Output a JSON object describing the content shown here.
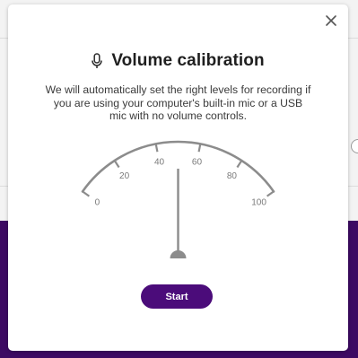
{
  "dialog": {
    "title": "Volume calibration",
    "description": "We will automatically set the right levels for recording if you are using your computer's built-in mic or a USB mic with no volume controls.",
    "close_icon": "close-icon",
    "title_icon": "microphone-icon",
    "start_label": "Start",
    "accent_color": "#4b0c7a"
  },
  "gauge": {
    "min": 0,
    "max": 100,
    "tick_labels": [
      "0",
      "20",
      "40",
      "60",
      "80",
      "100"
    ],
    "needle_value": 50,
    "color": "#8c8c8c"
  },
  "background": {
    "bottom_color": "#3d0a63"
  }
}
